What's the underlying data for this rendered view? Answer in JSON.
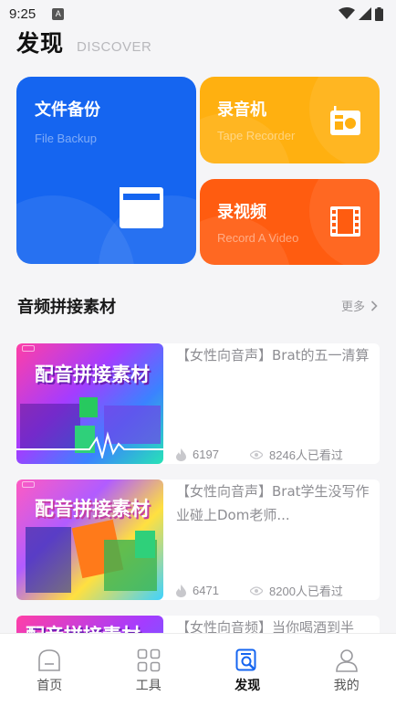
{
  "status_bar": {
    "time": "9:25",
    "notification_glyph": "A",
    "icons": [
      "wifi-icon",
      "signal-icon",
      "battery-icon"
    ]
  },
  "header": {
    "title": "发现",
    "subtitle": "DISCOVER"
  },
  "cards": {
    "backup": {
      "title": "文件备份",
      "subtitle": "File Backup",
      "color": "#1565f0",
      "icon": "folder-icon"
    },
    "recorder": {
      "title": "录音机",
      "subtitle": "Tape Recorder",
      "color": "#ffb010",
      "icon": "radio-icon"
    },
    "video": {
      "title": "录视频",
      "subtitle": "Record A Video",
      "color": "#ff5c10",
      "icon": "film-icon"
    }
  },
  "section": {
    "title": "音频拼接素材",
    "more": "更多"
  },
  "list": [
    {
      "title": "【女性向音声】Brat的五一清算",
      "likes": "6197",
      "views": "8246人已看过",
      "thumb_text": "配音拼接素材"
    },
    {
      "title": "【女性向音声】Brat学生没写作业碰上Dom老师...",
      "likes": "6471",
      "views": "8200人已看过",
      "thumb_text": "配音拼接素材"
    },
    {
      "title": "【女性向音频】当你喝酒到半",
      "thumb_text": "配音拼接素材"
    }
  ],
  "nav": {
    "items": [
      {
        "label": "首页",
        "icon": "home-icon"
      },
      {
        "label": "工具",
        "icon": "grid-icon"
      },
      {
        "label": "发现",
        "icon": "discover-icon",
        "active": true
      },
      {
        "label": "我的",
        "icon": "user-icon"
      }
    ],
    "active_color": "#1565f0"
  }
}
